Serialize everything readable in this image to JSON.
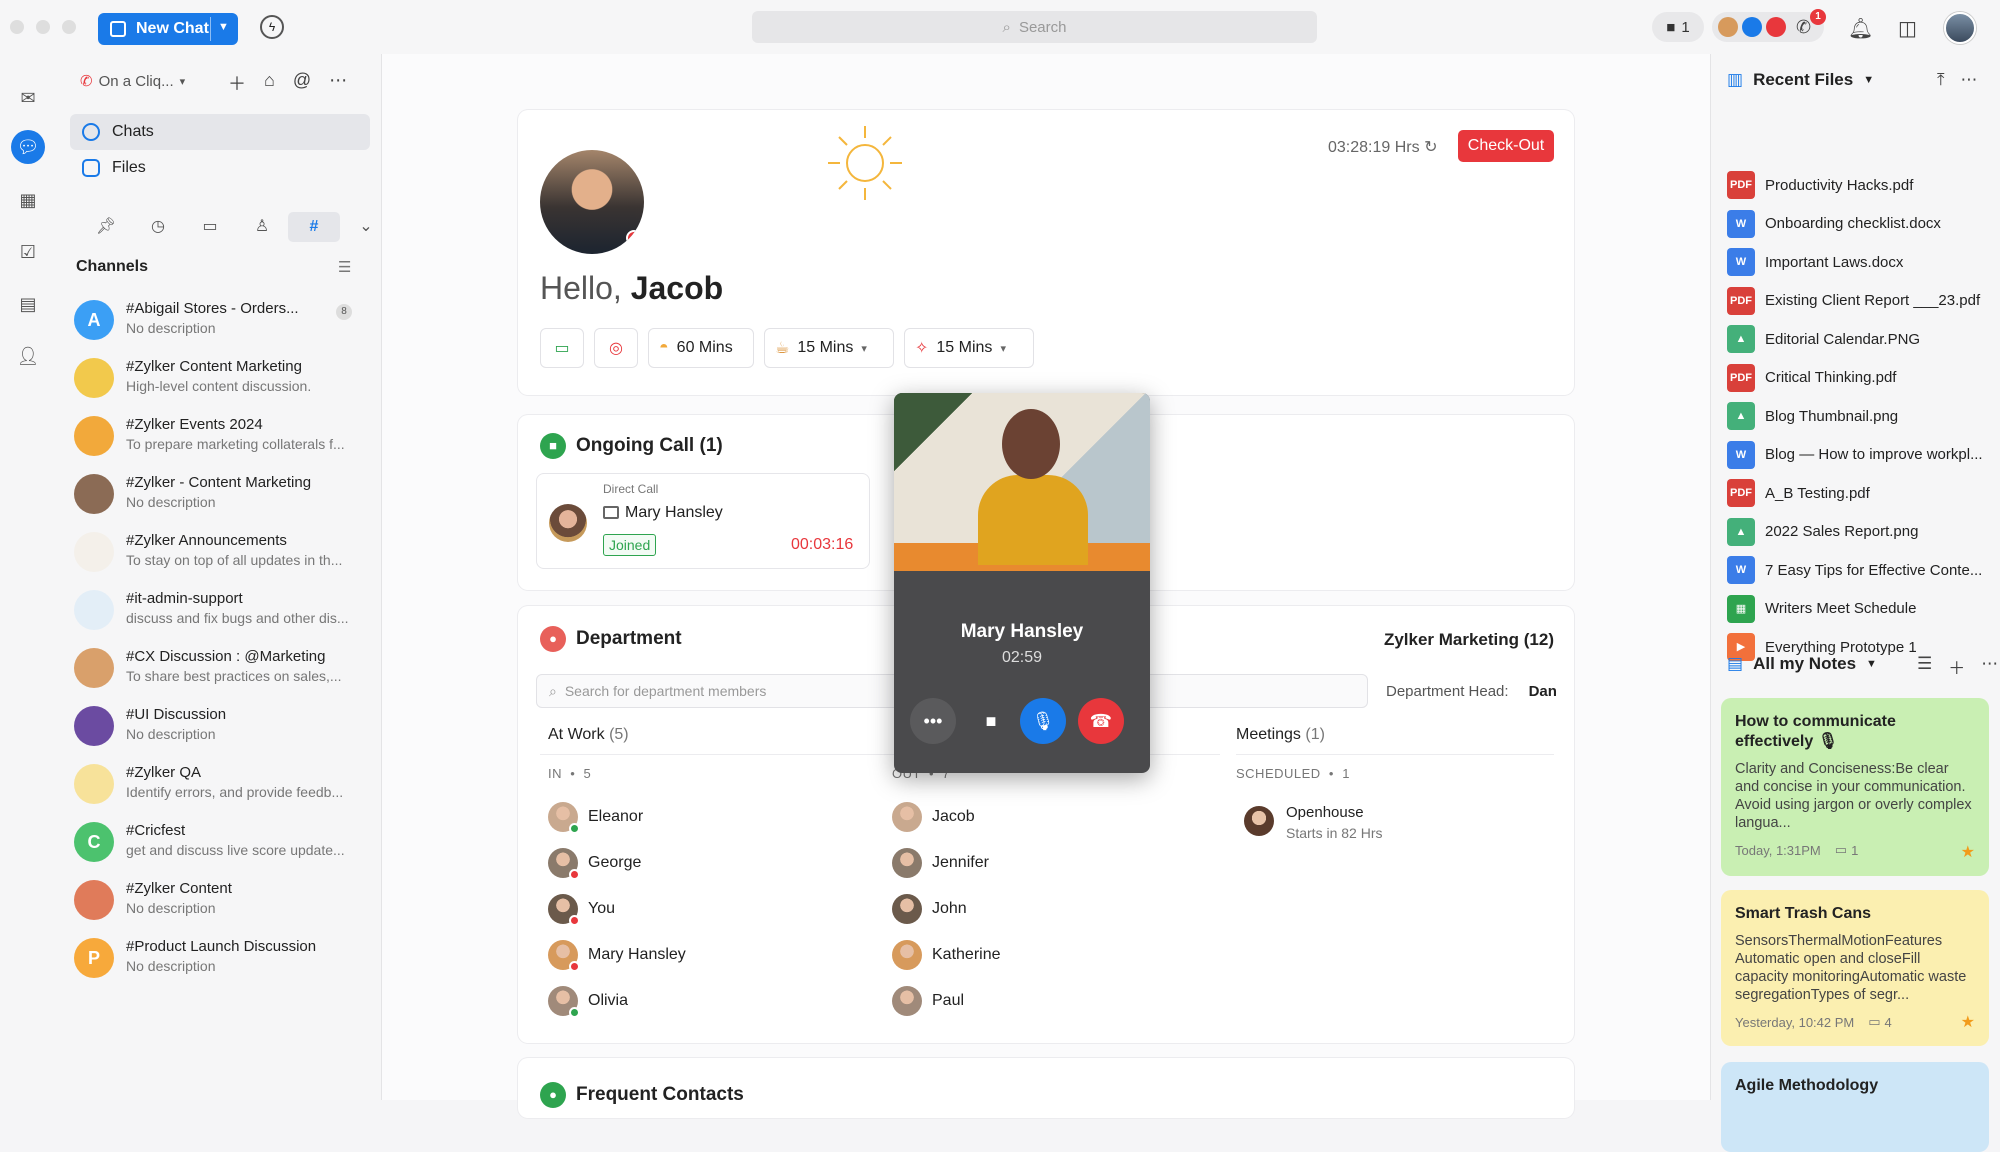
{
  "topbar": {
    "new_chat": "New Chat",
    "search_placeholder": "Search",
    "video_count": "1",
    "notification_badge": "1"
  },
  "sidebar": {
    "org": "On a Cliq...",
    "nav": [
      {
        "label": "Chats"
      },
      {
        "label": "Files"
      }
    ],
    "channels_heading": "Channels",
    "channels": [
      {
        "name": "#Abigail Stores - Orders...",
        "desc": "No description",
        "initial": "A",
        "color": "#3b9ff5",
        "count": "8"
      },
      {
        "name": "#Zylker Content Marketing",
        "desc": "High-level content discussion.",
        "initial": "",
        "color": "#f2c94c"
      },
      {
        "name": "#Zylker Events 2024",
        "desc": "To prepare marketing collaterals f...",
        "initial": "",
        "color": "#f2a93b"
      },
      {
        "name": "#Zylker - Content Marketing",
        "desc": "No description",
        "initial": "",
        "color": "#8b6b55"
      },
      {
        "name": "#Zylker Announcements",
        "desc": "To stay on top of all updates in th...",
        "initial": "",
        "color": "#f4f0ea"
      },
      {
        "name": "#it-admin-support",
        "desc": "discuss and fix bugs and other dis...",
        "initial": "",
        "color": "#e3eef7"
      },
      {
        "name": "#CX Discussion : @Marketing",
        "desc": "To share best practices on sales,...",
        "initial": "",
        "color": "#d9a06b"
      },
      {
        "name": "#UI Discussion",
        "desc": "No description",
        "initial": "",
        "color": "#6b4ba1"
      },
      {
        "name": "#Zylker QA",
        "desc": "Identify errors, and provide feedb...",
        "initial": "",
        "color": "#f7e29a"
      },
      {
        "name": "#Cricfest",
        "desc": "get and discuss live score update...",
        "initial": "C",
        "color": "#4cc26e"
      },
      {
        "name": "#Zylker Content",
        "desc": "No description",
        "initial": "",
        "color": "#e07b5a"
      },
      {
        "name": "#Product Launch Discussion",
        "desc": "No description",
        "initial": "P",
        "color": "#f7a93b"
      }
    ]
  },
  "hello": {
    "greeting": "Hello,",
    "name": "Jacob",
    "timer": "03:28:19 Hrs",
    "checkout": "Check-Out",
    "chips": [
      "60 Mins",
      "15 Mins",
      "15 Mins"
    ]
  },
  "ongoing": {
    "title": "Ongoing Call (1)",
    "type": "Direct Call",
    "caller": "Mary Hansley",
    "status": "Joined",
    "duration": "00:03:16"
  },
  "department": {
    "title": "Department",
    "group": "Zylker Marketing (12)",
    "search_placeholder": "Search for department members",
    "head_label": "Department Head:",
    "head_name": "Dan",
    "at_work": "At Work",
    "at_work_count": "(5)",
    "in_label": "IN",
    "in_count": "5",
    "out_label": "OUT",
    "out_count": "7",
    "in_members": [
      "Eleanor",
      "George",
      "You",
      "Mary Hansley",
      "Olivia"
    ],
    "out_members": [
      "Jacob",
      "Jennifer",
      "John",
      "Katherine",
      "Paul"
    ],
    "meetings": "Meetings",
    "meetings_count": "(1)",
    "scheduled_label": "SCHEDULED",
    "scheduled_count": "1",
    "meeting_name": "Openhouse",
    "meeting_time": "Starts in 82 Hrs"
  },
  "frequent": {
    "title": "Frequent Contacts"
  },
  "call_popup": {
    "name": "Mary Hansley",
    "time": "02:59"
  },
  "recent_files": {
    "title": "Recent Files",
    "files": [
      {
        "name": "Productivity Hacks.pdf",
        "kind": "pdf"
      },
      {
        "name": "Onboarding checklist.docx",
        "kind": "doc"
      },
      {
        "name": "Important Laws.docx",
        "kind": "doc"
      },
      {
        "name": "Existing Client Report ___23.pdf",
        "kind": "pdf"
      },
      {
        "name": "Editorial Calendar.PNG",
        "kind": "img"
      },
      {
        "name": "Critical Thinking.pdf",
        "kind": "pdf"
      },
      {
        "name": "Blog Thumbnail.png",
        "kind": "img"
      },
      {
        "name": "Blog — How to improve workpl...",
        "kind": "doc"
      },
      {
        "name": "A_B Testing.pdf",
        "kind": "pdf"
      },
      {
        "name": "2022 Sales Report.png",
        "kind": "img"
      },
      {
        "name": "7 Easy Tips for Effective Conte...",
        "kind": "doc"
      },
      {
        "name": "Writers Meet Schedule",
        "kind": "sheet"
      },
      {
        "name": "Everything Prototype 1",
        "kind": "slide"
      }
    ]
  },
  "notes": {
    "title": "All my Notes",
    "items": [
      {
        "title": "How to communicate effectively 🎙",
        "body": "Clarity and Conciseness:Be clear and concise in your communication. Avoid using jargon or overly complex langua...",
        "date": "Today, 1:31PM",
        "comments": "1",
        "color": "#c9efb3"
      },
      {
        "title": "Smart Trash Cans",
        "body": "SensorsThermalMotionFeatures Automatic open and closeFill capacity monitoringAutomatic waste segregationTypes of segr...",
        "date": "Yesterday, 10:42 PM",
        "comments": "4",
        "color": "#fbefb0"
      },
      {
        "title": "Agile Methodology",
        "body": "",
        "date": "",
        "comments": "",
        "color": "#cde6f7"
      }
    ]
  },
  "colors": {
    "accent": "#1a7ae8",
    "danger": "#e8373c",
    "success": "#2ea44f"
  }
}
